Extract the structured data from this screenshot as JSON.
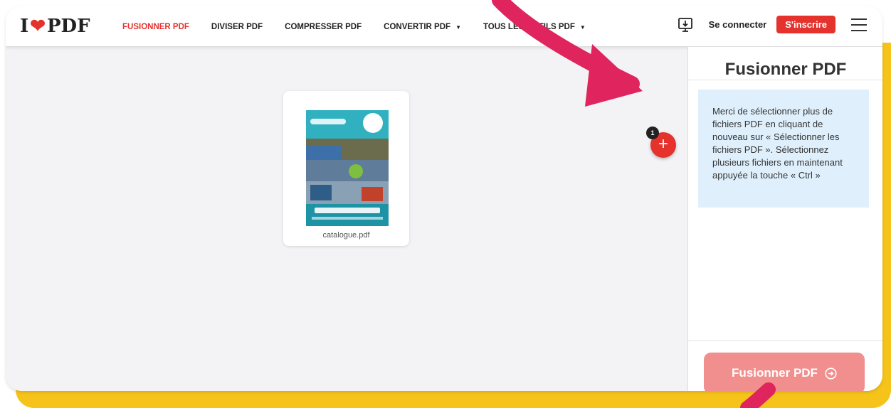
{
  "navbar": {
    "logo_left": "I",
    "logo_right": "PDF",
    "items": [
      {
        "label": "FUSIONNER PDF",
        "active": true
      },
      {
        "label": "DIVISER PDF"
      },
      {
        "label": "COMPRESSER PDF"
      },
      {
        "label": "CONVERTIR PDF",
        "dropdown": true
      },
      {
        "label": "TOUS LES OUTILS PDF",
        "dropdown": true
      }
    ],
    "login": "Se connecter",
    "signup": "S'inscrire",
    "icons": [
      "desktop-download-icon",
      "hamburger-menu-icon"
    ]
  },
  "workspace": {
    "file_name": "catalogue.pdf",
    "file_count_badge": "1",
    "add_button_label": "+"
  },
  "sidebar": {
    "title": "Fusionner PDF",
    "info": "Merci de sélectionner plus de fichiers PDF en cliquant de nouveau sur « Sélectionner les fichiers PDF ». Sélectionnez plusieurs fichiers en maintenant appuyée la touche « Ctrl »",
    "merge_button": "Fusionner PDF"
  },
  "colors": {
    "accent": "#e5322d",
    "highlight": "#f5c31a",
    "annotation_arrow": "#e0245e",
    "info_box": "#dff0fc"
  }
}
